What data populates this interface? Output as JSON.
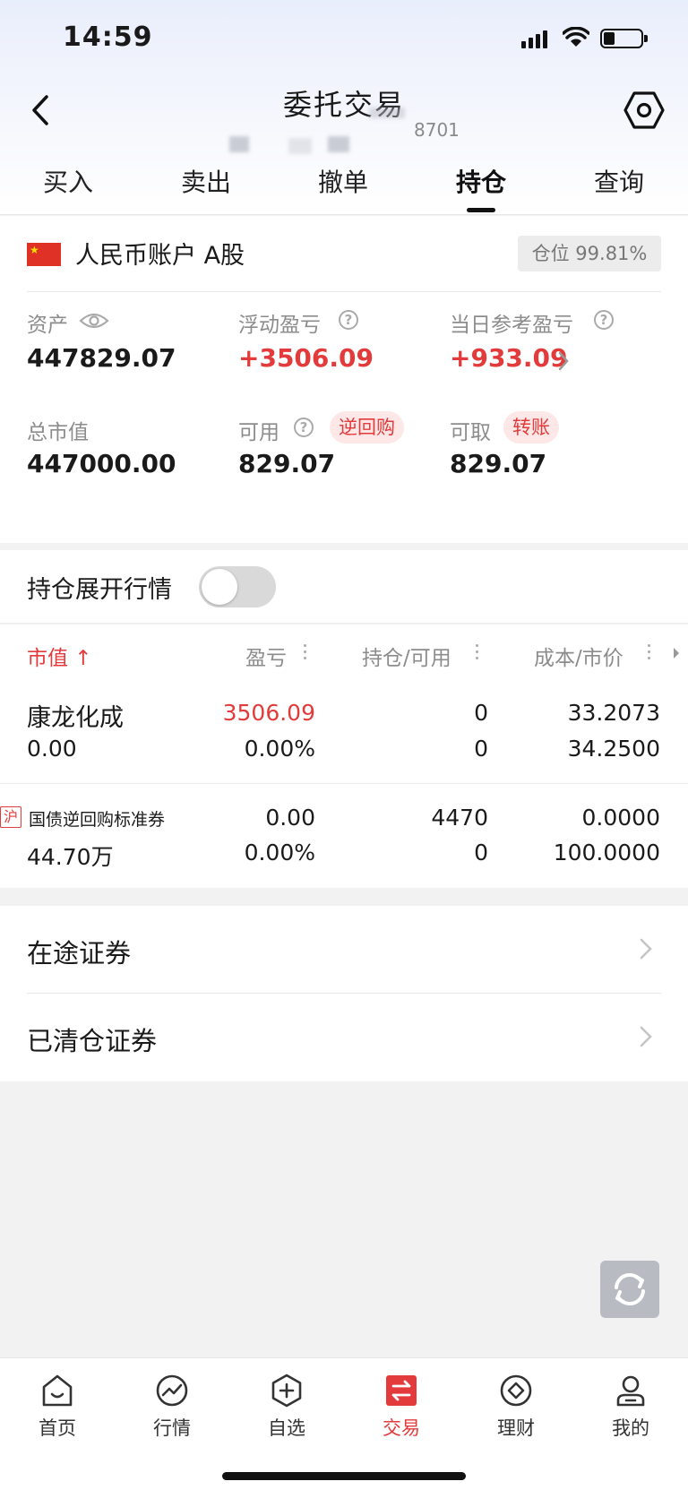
{
  "status_bar": {
    "time": "14:59"
  },
  "nav": {
    "title": "委托交易",
    "account_suffix": "8701"
  },
  "tabs": [
    {
      "label": "买入"
    },
    {
      "label": "卖出"
    },
    {
      "label": "撤单"
    },
    {
      "label": "持仓",
      "active": true
    },
    {
      "label": "查询"
    }
  ],
  "account": {
    "name": "人民币账户 A股",
    "position_ratio": "仓位 99.81%",
    "stats": {
      "assets": {
        "label": "资产",
        "value": "447829.07"
      },
      "floating_pnl": {
        "label": "浮动盈亏",
        "value": "+3506.09"
      },
      "daily_pnl": {
        "label": "当日参考盈亏",
        "value": "+933.09"
      },
      "market_value": {
        "label": "总市值",
        "value": "447000.00"
      },
      "available": {
        "label": "可用",
        "value": "829.07",
        "tag": "逆回购"
      },
      "withdrawable": {
        "label": "可取",
        "value": "829.07",
        "tag": "转账"
      }
    }
  },
  "toggle": {
    "label": "持仓展开行情",
    "on": false
  },
  "holdings": {
    "headers": {
      "market_value": "市值 ↑",
      "pnl": "盈亏",
      "position": "持仓/可用",
      "cost_price": "成本/市价"
    },
    "rows": [
      {
        "name": "康龙化成",
        "market_value": "0.00",
        "pnl": "3506.09",
        "pnl_pct": "0.00%",
        "position": "0",
        "available": "0",
        "cost": "33.2073",
        "price": "34.2500"
      },
      {
        "exchange_badge": "沪",
        "name": "国债逆回购标准券",
        "market_value": "44.70万",
        "pnl": "0.00",
        "pnl_pct": "0.00%",
        "position": "4470",
        "available": "0",
        "cost": "0.0000",
        "price": "100.0000"
      }
    ]
  },
  "links": [
    {
      "label": "在途证券"
    },
    {
      "label": "已清仓证券"
    }
  ],
  "bottom_nav": [
    {
      "label": "首页",
      "icon": "home-icon"
    },
    {
      "label": "行情",
      "icon": "chart-icon"
    },
    {
      "label": "自选",
      "icon": "plus-hexagon-icon"
    },
    {
      "label": "交易",
      "icon": "swap-icon",
      "active": true
    },
    {
      "label": "理财",
      "icon": "diamond-icon"
    },
    {
      "label": "我的",
      "icon": "user-icon"
    }
  ],
  "colors": {
    "accent_red": "#e33b3b",
    "text_gray": "#8c8c8c"
  }
}
